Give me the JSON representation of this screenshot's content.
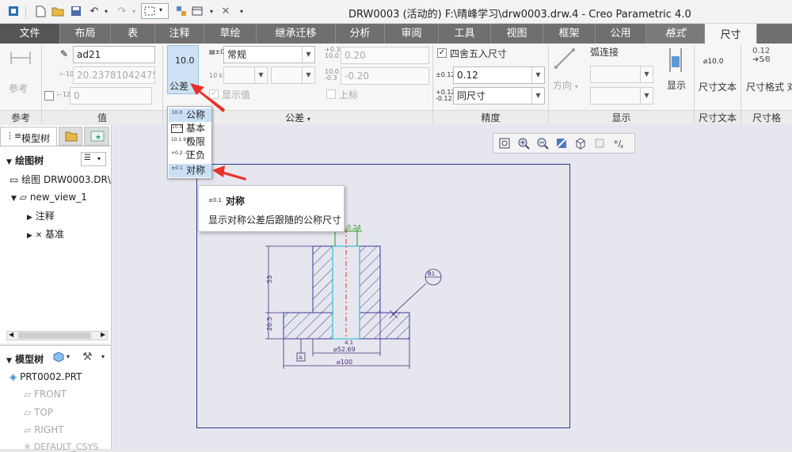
{
  "window": {
    "title": "DRW0003 (活动的) F:\\晴峰学习\\drw0003.drw.4 - Creo Parametric 4.0"
  },
  "tabs": [
    {
      "label": "文件"
    },
    {
      "label": "布局"
    },
    {
      "label": "表"
    },
    {
      "label": "注释"
    },
    {
      "label": "草绘"
    },
    {
      "label": "继承迁移"
    },
    {
      "label": "分析"
    },
    {
      "label": "审阅"
    },
    {
      "label": "工具"
    },
    {
      "label": "视图"
    },
    {
      "label": "框架"
    },
    {
      "label": "公用"
    },
    {
      "label": "格式"
    },
    {
      "label": "尺寸"
    }
  ],
  "ribbon": {
    "reference": {
      "button_label": "参考",
      "group_label": "参考"
    },
    "value": {
      "name_value": "ad21",
      "nominal_value": "20.23781042475",
      "override_value": "0",
      "group_label": "值"
    },
    "tolerance": {
      "value_icon_text": "10.0",
      "button_label": "公差",
      "display_select": "常规",
      "upper_value": "0.20",
      "lower_value": "-0.20",
      "show_value_label": "显示值",
      "upper_label": "上标",
      "group_label": "公差"
    },
    "precision": {
      "rounding_label": "四舍五入尺寸",
      "decimal_value": "0.12",
      "tolerance_decimal": "同尺寸",
      "group_label": "精度"
    },
    "display": {
      "direction_label": "方向",
      "arc_label": "弧连接",
      "show_label": "显示",
      "group_label": "显示"
    },
    "dim_text": {
      "icon_text": "⌀10.0",
      "button_label": "尺寸文本",
      "group_label": "尺寸文本"
    },
    "dim_format": {
      "button_label": "尺寸格式",
      "extra_label": "对",
      "group_label": "尺寸格"
    }
  },
  "tolerance_menu": {
    "items": [
      {
        "label": "公称",
        "icon": "10.0"
      },
      {
        "label": "基本",
        "icon": "10.0"
      },
      {
        "label": "极限",
        "icon": "10.1 9.9"
      },
      {
        "label": "正负",
        "icon": "+0.2 -0.1"
      },
      {
        "label": "对称",
        "icon": "±0.1"
      }
    ]
  },
  "tooltip": {
    "icon": "±0.1",
    "title": "对称",
    "text": "显示对称公差后跟随的公称尺寸"
  },
  "model_tree_top": {
    "tab_label": "模型树",
    "section_label": "绘图树",
    "root": "绘图 DRW0003.DR\\",
    "view": "new_view_1",
    "children": [
      "注释",
      "基准"
    ]
  },
  "model_tree_bottom": {
    "section_label": "模型树",
    "part": "PRT0002.PRT",
    "items": [
      "FRONT",
      "TOP",
      "RIGHT",
      "DEFAULT_CSYS"
    ]
  },
  "drawing": {
    "dim_53": "53",
    "dim_20_5": "20.5",
    "dim_52_69": "⌀52.69",
    "dim_100": "⌀100",
    "dim_0_24": "0.24",
    "dim_4_1": "4.1",
    "datum_a": "A",
    "balloon_b1": "B1",
    "sheet_color": "#2a3a8a",
    "hatch_color": "#3a3a9a",
    "dim_color": "#4a2a7a",
    "green_color": "#1aa01a",
    "cyan_color": "#18b8c8"
  },
  "colors": {
    "accent": "#c9e0f7",
    "arrow": "#e8322a"
  }
}
